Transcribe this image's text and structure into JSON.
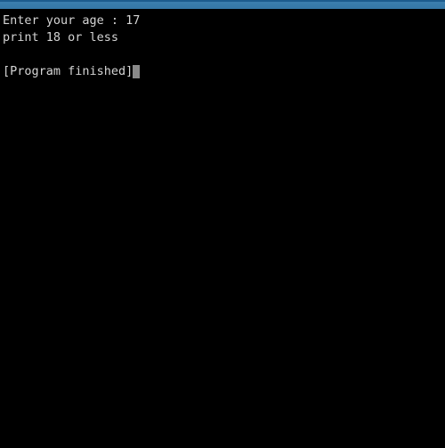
{
  "window": {
    "title_bar": {
      "name": "console-title-bar",
      "color": "#3a7cab",
      "edge_color": "#1d5c8d",
      "label": ""
    }
  },
  "console": {
    "background_color": "#000000",
    "text_color": "#d4d4d4",
    "cursor_color": "#8a8a8a",
    "lines": [
      {
        "text": "Enter your age : 17",
        "kind": "output"
      },
      {
        "text": "print 18 or less",
        "kind": "output"
      },
      {
        "text": "",
        "kind": "blank"
      },
      {
        "text": "[Program finished]",
        "kind": "status"
      }
    ],
    "prompt_text": "Enter your age : ",
    "input_value": "17",
    "result_text": "print 18 or less",
    "status_text": "[Program finished]",
    "cursor": "block-cursor"
  }
}
